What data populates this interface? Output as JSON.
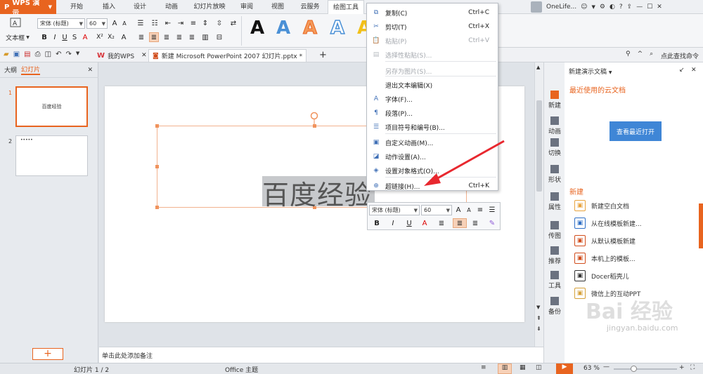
{
  "app": {
    "name": "WPS 演示"
  },
  "menu_tabs": [
    "开始",
    "插入",
    "设计",
    "动画",
    "幻灯片放映",
    "审阅",
    "视图",
    "云服务",
    "绘图工具"
  ],
  "user": {
    "name": "OneLife..."
  },
  "ribbon": {
    "textbox_label": "文本框",
    "font_name": "宋体 (标题)",
    "font_size": "60",
    "wordart": [
      "A",
      "A",
      "A",
      "A",
      "A"
    ]
  },
  "doc_tabs": [
    {
      "label": "我的WPS"
    },
    {
      "label": "新建 Microsoft PowerPoint 2007 幻灯片.pptx *"
    }
  ],
  "search_cmd": "点此查找命令",
  "left_panel": {
    "tabs": [
      "大纲",
      "幻灯片"
    ],
    "slides": [
      {
        "num": "1",
        "title": "百度经验"
      },
      {
        "num": "2",
        "title": "•••••"
      }
    ]
  },
  "slide": {
    "text": "百度经验"
  },
  "context_menu": [
    {
      "label": "复制(C)",
      "shortcut": "Ctrl+C",
      "icon": "copy-icon",
      "disabled": false
    },
    {
      "label": "剪切(T)",
      "shortcut": "Ctrl+X",
      "icon": "scissors-icon",
      "disabled": false
    },
    {
      "label": "粘贴(P)",
      "shortcut": "Ctrl+V",
      "icon": "paste-icon",
      "disabled": true
    },
    {
      "label": "选择性粘贴(S)...",
      "shortcut": "",
      "icon": "paste-special-icon",
      "disabled": true
    },
    {
      "label": "另存为图片(S)...",
      "shortcut": "",
      "icon": "",
      "disabled": true
    },
    {
      "label": "退出文本编辑(X)",
      "shortcut": "",
      "icon": "",
      "disabled": false
    },
    {
      "label": "字体(F)...",
      "shortcut": "",
      "icon": "font-icon",
      "disabled": false
    },
    {
      "label": "段落(P)...",
      "shortcut": "",
      "icon": "paragraph-icon",
      "disabled": false
    },
    {
      "label": "项目符号和编号(B)...",
      "shortcut": "",
      "icon": "bullets-icon",
      "disabled": false
    },
    {
      "label": "自定义动画(M)...",
      "shortcut": "",
      "icon": "animation-icon",
      "disabled": false
    },
    {
      "label": "动作设置(A)...",
      "shortcut": "",
      "icon": "action-icon",
      "disabled": false
    },
    {
      "label": "设置对象格式(O)...",
      "shortcut": "",
      "icon": "format-object-icon",
      "disabled": false
    },
    {
      "label": "超链接(H)...",
      "shortcut": "Ctrl+K",
      "icon": "hyperlink-icon",
      "disabled": false
    }
  ],
  "mini_toolbar": {
    "font_name": "宋体 (标题)",
    "font_size": "60"
  },
  "notes_placeholder": "单击此处添加备注",
  "right_nav": [
    "新建",
    "动画",
    "切换",
    "形状",
    "属性",
    "传图",
    "推荐",
    "工具",
    "备份"
  ],
  "right_panel": {
    "header": "新建演示文稿",
    "recent_title": "最近使用的云文档",
    "open_recent": "查看最近打开",
    "new_title": "新建",
    "items": [
      "新建空白文档",
      "从在线模板新建...",
      "从默认模板新建",
      "本机上的模板...",
      "Docer稻壳儿",
      "微信上的互动PPT"
    ]
  },
  "status": {
    "slide": "幻灯片 1 / 2",
    "theme": "Office 主题",
    "zoom": "63 %"
  },
  "watermark": {
    "brand": "Bai 经验",
    "url": "jingyan.baidu.com"
  },
  "colors": {
    "accent": "#e8641f",
    "blue_button": "#3f86d6",
    "arrow": "#e8282f"
  }
}
